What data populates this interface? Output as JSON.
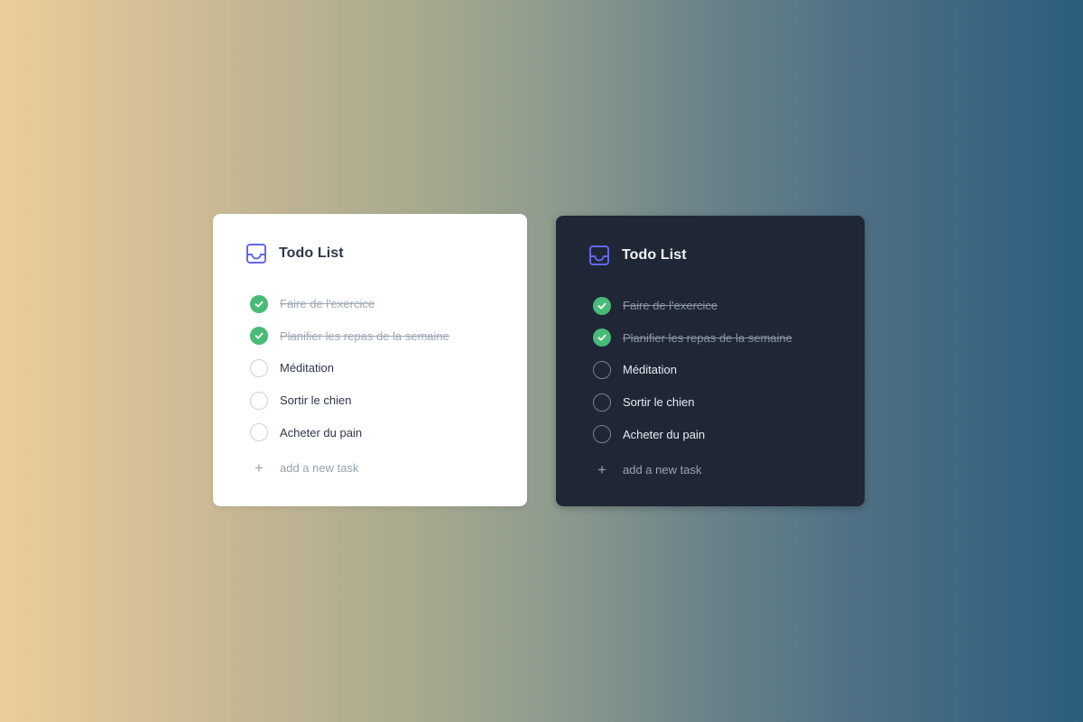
{
  "colors": {
    "accent_icon": "#6366f1",
    "done_green": "#48bb78",
    "light_card_bg": "#ffffff",
    "dark_card_bg": "#1f2736"
  },
  "icons": {
    "header": "inbox-icon",
    "done": "check-icon",
    "add": "plus-icon"
  },
  "light_card": {
    "title": "Todo List",
    "tasks": [
      {
        "label": "Faire de l'exercice",
        "done": true
      },
      {
        "label": "Planifier les repas de la semaine",
        "done": true
      },
      {
        "label": "Méditation",
        "done": false
      },
      {
        "label": "Sortir le chien",
        "done": false
      },
      {
        "label": "Acheter du pain",
        "done": false
      }
    ],
    "add_label": "add a new task"
  },
  "dark_card": {
    "title": "Todo List",
    "tasks": [
      {
        "label": "Faire de l'exercice",
        "done": true
      },
      {
        "label": "Planifier les repas de la semaine",
        "done": true
      },
      {
        "label": "Méditation",
        "done": false
      },
      {
        "label": "Sortir le chien",
        "done": false
      },
      {
        "label": "Acheter du pain",
        "done": false
      }
    ],
    "add_label": "add a new task"
  }
}
